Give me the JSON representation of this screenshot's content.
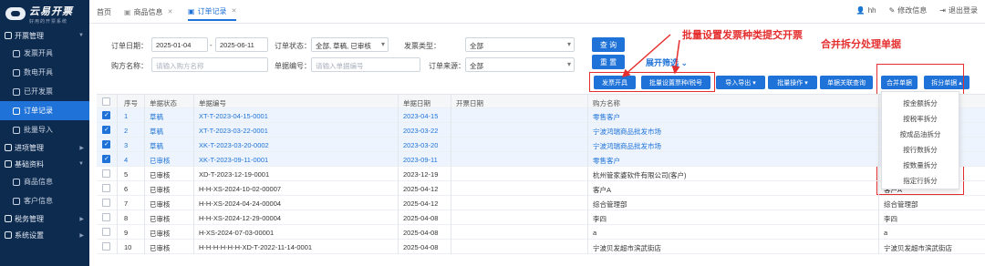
{
  "sidebar": {
    "logo_title": "云易开票",
    "logo_sub": "好用的开票系统",
    "groups": [
      {
        "label": "开票管理",
        "items": [
          "发票开具",
          "数电开具",
          "已开发票",
          "订单记录",
          "批量导入"
        ]
      },
      {
        "label": "进项管理",
        "items": []
      },
      {
        "label": "基础资料",
        "items": [
          "商品信息",
          "客户信息"
        ]
      },
      {
        "label": "税务管理",
        "items": []
      },
      {
        "label": "系统设置",
        "items": []
      }
    ]
  },
  "topbar": {
    "tabs": [
      "首页",
      "商品信息",
      "订单记录"
    ],
    "user": "hh",
    "change_password": "修改信息",
    "logout": "退出登录"
  },
  "filters": {
    "order_date_label": "订单日期：",
    "date_start": "2025-01-04",
    "date_sep": "-",
    "date_end": "2025-06-11",
    "order_status_label": "订单状态：",
    "order_status_value": "全部, 草稿, 已审核",
    "invoice_type_label": "发票类型：",
    "invoice_type_value": "全部",
    "buyer_label": "购方名称：",
    "buyer_placeholder": "请输入购方名称",
    "doc_no_label": "单据编号：",
    "doc_no_placeholder": "请输入单据编号",
    "source_label": "订单来源：",
    "source_value": "全部",
    "query": "查 询",
    "reset": "重 置",
    "expand": "展开筛选"
  },
  "toolbar": {
    "issue": "发票开具",
    "batch_set": "批量设置票种/税号",
    "import_export": "导入导出",
    "batch_op": "批量操作",
    "doc_link": "单据关联查询",
    "merge": "合并单据",
    "split": "拆分单据"
  },
  "annotations": {
    "left": "批量设置发票种类提交开票",
    "right": "合并拆分处理单据"
  },
  "table": {
    "headers": [
      "序号",
      "单据状态",
      "单据编号",
      "单据日期",
      "开票日期",
      "购方名称"
    ],
    "rows": [
      {
        "idx": "1",
        "status": "草稿",
        "no": "XT-T-2023-04-15-0001",
        "date": "2023-04-15",
        "buyer": "零售客户",
        "extra": "",
        "checked": true
      },
      {
        "idx": "2",
        "status": "草稿",
        "no": "XT-T-2023-03-22-0001",
        "date": "2023-03-22",
        "buyer": "宁波鸿瑞商品批发市场",
        "extra": "",
        "checked": true
      },
      {
        "idx": "3",
        "status": "草稿",
        "no": "XK-T-2023-03-20-0002",
        "date": "2023-03-20",
        "buyer": "宁波鸿瑞商品批发市场",
        "extra": "",
        "checked": true
      },
      {
        "idx": "4",
        "status": "已审核",
        "no": "XK-T-2023-09-11-0001",
        "date": "2023-09-11",
        "buyer": "零售客户",
        "extra": "",
        "checked": true
      },
      {
        "idx": "5",
        "status": "已审核",
        "no": "XD-T-2023-12-19-0001",
        "date": "2023-12-19",
        "buyer": "杭州管家婆软件有限公司(客户)",
        "extra": "",
        "checked": false
      },
      {
        "idx": "6",
        "status": "已审核",
        "no": "H-H-XS-2024-10-02-00007",
        "date": "2025-04-12",
        "buyer": "客户A",
        "extra": "客户A",
        "checked": false
      },
      {
        "idx": "7",
        "status": "已审核",
        "no": "H-H-XS-2024-04-24-00004",
        "date": "2025-04-12",
        "buyer": "综合管理部",
        "extra": "综合管理部",
        "checked": false
      },
      {
        "idx": "8",
        "status": "已审核",
        "no": "H-H-XS-2024-12-29-00004",
        "date": "2025-04-08",
        "buyer": "李四",
        "extra": "李四",
        "checked": false
      },
      {
        "idx": "9",
        "status": "已审核",
        "no": "H-XS-2024-07-03-00001",
        "date": "2025-04-08",
        "buyer": "a",
        "extra": "a",
        "checked": false
      },
      {
        "idx": "10",
        "status": "已审核",
        "no": "H-H-H-H-H-H-XD-T-2022-11-14-0001",
        "date": "2025-04-08",
        "buyer": "宁波贝发超市滨武街店",
        "extra": "宁波贝发超市滨武街店",
        "checked": false
      }
    ]
  },
  "split_menu": [
    "按金额拆分",
    "按税率拆分",
    "按成品油拆分",
    "按行数拆分",
    "按数量拆分",
    "指定行拆分"
  ],
  "colors": {
    "accent": "#1e72d8",
    "sidebar": "#0d2a4f",
    "annotation": "#e52e2e"
  }
}
